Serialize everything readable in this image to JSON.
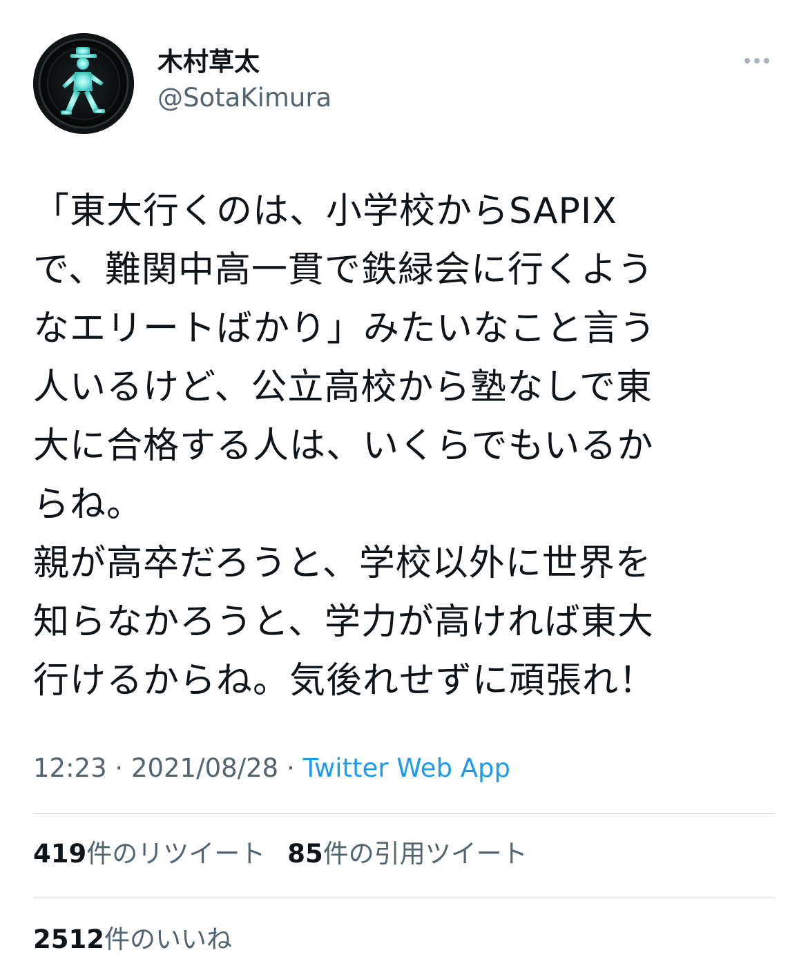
{
  "user": {
    "display_name": "木村草太",
    "handle": "@SotaKimura",
    "avatar_icon": "pedestrian-signal-icon"
  },
  "menu_icon": "more-dots-icon",
  "tweet": {
    "text": "「東大行くのは、小学校からSAPIX\nで、難関中高一貫で鉄緑会に行くよう\nなエリートばかり」みたいなこと言う\n人いるけど、公立高校から塾なしで東\n大に合格する人は、いくらでもいるか\nらね。\n親が高卒だろうと、学校以外に世界を\n知らなかろうと、学力が高ければ東大\n行けるからね。気後れせずに頑張れ！"
  },
  "meta": {
    "time": "12:23",
    "sep1": " · ",
    "date": "2021/08/28",
    "sep2": " · ",
    "source": "Twitter Web App"
  },
  "stats": {
    "retweets": {
      "count": "419",
      "label": "件のリツイート"
    },
    "quotes": {
      "count": "85",
      "label": "件の引用ツイート"
    },
    "likes": {
      "count": "2512",
      "label": "件のいいね"
    }
  },
  "colors": {
    "text": "#0f1419",
    "secondary": "#536471",
    "link": "#1d9bf0",
    "divider": "#cfd9de",
    "signal_glow": "#7ee8e0"
  }
}
